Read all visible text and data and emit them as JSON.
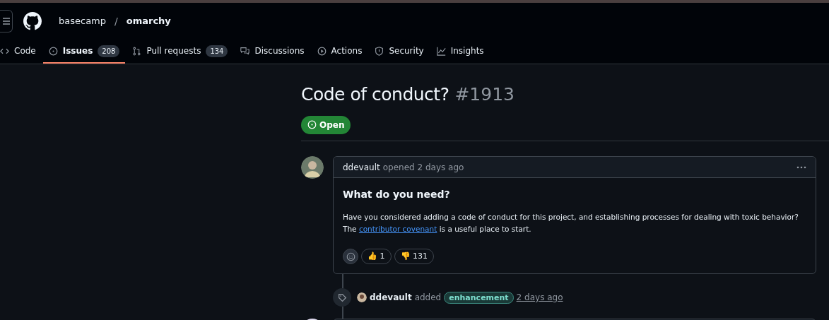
{
  "breadcrumb": {
    "owner": "basecamp",
    "separator": "/",
    "repo": "omarchy"
  },
  "tabs": [
    {
      "kind": "code",
      "label": "Code",
      "selected": false
    },
    {
      "kind": "issues",
      "label": "Issues",
      "count": "208",
      "selected": true
    },
    {
      "kind": "pulls",
      "label": "Pull requests",
      "count": "134",
      "selected": false
    },
    {
      "kind": "discussions",
      "label": "Discussions",
      "selected": false
    },
    {
      "kind": "actions",
      "label": "Actions",
      "selected": false
    },
    {
      "kind": "security",
      "label": "Security",
      "selected": false
    },
    {
      "kind": "insights",
      "label": "Insights",
      "selected": false
    }
  ],
  "issue": {
    "title": "Code of conduct?",
    "number": "#1913",
    "state": "Open"
  },
  "comment": {
    "author": "ddevault",
    "meta": "opened 2 days ago",
    "heading": "What do you need?",
    "body": "Have you considered adding a code of conduct for this project, and establishing processes for dealing with toxic behavior?",
    "body2_before": "The",
    "link": "contributor covenant",
    "body2_after": "is a useful place to start.",
    "reactions": [
      {
        "emoji": "👍",
        "count": "1"
      },
      {
        "emoji": "👎",
        "count": "131"
      }
    ]
  },
  "event": {
    "actor": "ddevault",
    "action": "added",
    "label": "enhancement",
    "time": "2 days ago"
  }
}
